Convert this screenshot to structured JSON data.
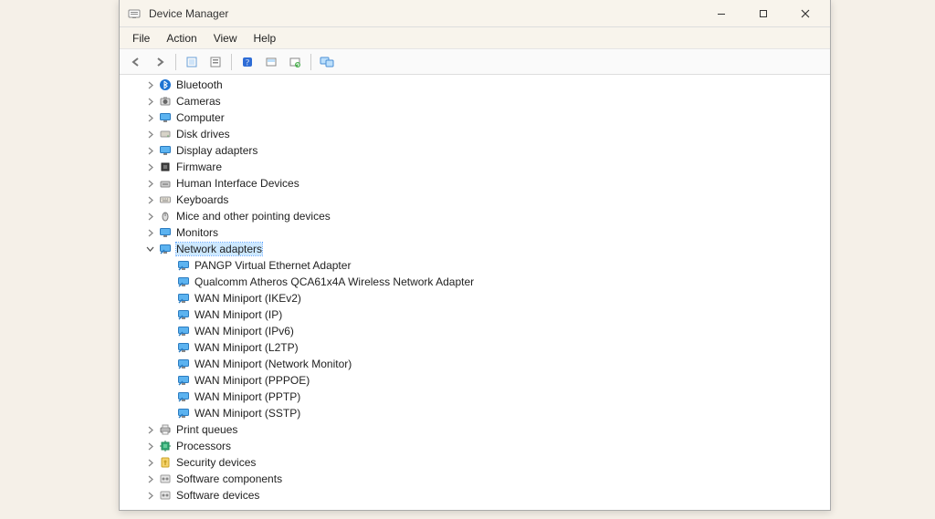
{
  "window": {
    "title": "Device Manager"
  },
  "menu": {
    "file": "File",
    "action": "Action",
    "view": "View",
    "help": "Help"
  },
  "tree": {
    "categories": [
      {
        "label": "Bluetooth",
        "icon": "bluetooth",
        "expanded": false
      },
      {
        "label": "Cameras",
        "icon": "camera",
        "expanded": false
      },
      {
        "label": "Computer",
        "icon": "monitor",
        "expanded": false
      },
      {
        "label": "Disk drives",
        "icon": "disk",
        "expanded": false
      },
      {
        "label": "Display adapters",
        "icon": "monitor",
        "expanded": false
      },
      {
        "label": "Firmware",
        "icon": "chip",
        "expanded": false
      },
      {
        "label": "Human Interface Devices",
        "icon": "hid",
        "expanded": false
      },
      {
        "label": "Keyboards",
        "icon": "keyboard",
        "expanded": false
      },
      {
        "label": "Mice and other pointing devices",
        "icon": "mouse",
        "expanded": false
      },
      {
        "label": "Monitors",
        "icon": "monitor",
        "expanded": false
      },
      {
        "label": "Network adapters",
        "icon": "network",
        "expanded": true,
        "selected": true,
        "children": [
          {
            "label": "PANGP Virtual Ethernet Adapter",
            "icon": "network"
          },
          {
            "label": "Qualcomm Atheros QCA61x4A Wireless Network Adapter",
            "icon": "network"
          },
          {
            "label": "WAN Miniport (IKEv2)",
            "icon": "network"
          },
          {
            "label": "WAN Miniport (IP)",
            "icon": "network"
          },
          {
            "label": "WAN Miniport (IPv6)",
            "icon": "network"
          },
          {
            "label": "WAN Miniport (L2TP)",
            "icon": "network"
          },
          {
            "label": "WAN Miniport (Network Monitor)",
            "icon": "network"
          },
          {
            "label": "WAN Miniport (PPPOE)",
            "icon": "network"
          },
          {
            "label": "WAN Miniport (PPTP)",
            "icon": "network"
          },
          {
            "label": "WAN Miniport (SSTP)",
            "icon": "network"
          }
        ]
      },
      {
        "label": "Print queues",
        "icon": "printer",
        "expanded": false
      },
      {
        "label": "Processors",
        "icon": "cpu",
        "expanded": false
      },
      {
        "label": "Security devices",
        "icon": "security",
        "expanded": false
      },
      {
        "label": "Software components",
        "icon": "software",
        "expanded": false
      },
      {
        "label": "Software devices",
        "icon": "software",
        "expanded": false
      }
    ]
  }
}
